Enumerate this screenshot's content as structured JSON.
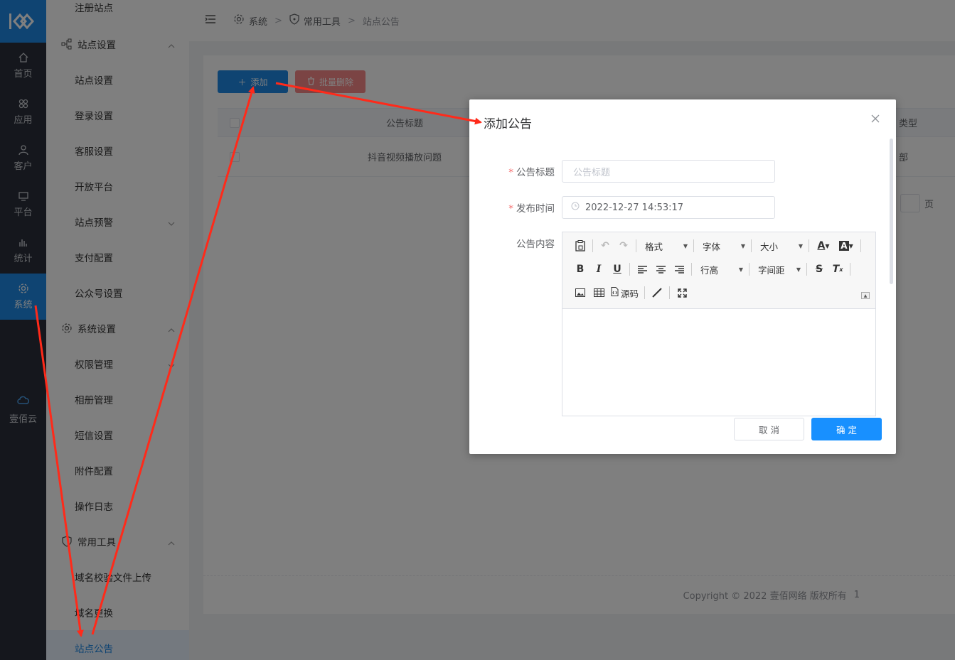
{
  "rail": {
    "items": [
      {
        "label": "首页",
        "icon": "home-icon"
      },
      {
        "label": "应用",
        "icon": "apps-icon"
      },
      {
        "label": "客户",
        "icon": "user-icon"
      },
      {
        "label": "平台",
        "icon": "monitor-icon"
      },
      {
        "label": "统计",
        "icon": "bar-chart-icon"
      },
      {
        "label": "系统",
        "icon": "gear-icon",
        "active": true
      }
    ],
    "cloud_label": "壹佰云"
  },
  "submenu": {
    "top_item": "注册站点",
    "group_site": "站点设置",
    "site_items": [
      "站点设置",
      "登录设置",
      "客服设置",
      "开放平台",
      "站点预警",
      "支付配置",
      "公众号设置"
    ],
    "group_system": "系统设置",
    "system_items": [
      "权限管理",
      "相册管理",
      "短信设置",
      "附件配置",
      "操作日志"
    ],
    "group_tools": "常用工具",
    "tools_items": [
      "域名校验文件上传",
      "域名更换",
      "站点公告"
    ]
  },
  "breadcrumb": {
    "level1": "系统",
    "level2": "常用工具",
    "level3": "站点公告"
  },
  "toolbar_buttons": {
    "add": "添加",
    "batch_delete": "批量删除"
  },
  "table": {
    "col_title": "公告标题",
    "col_type": "类型",
    "rows": [
      {
        "title": "抖音视频播放问题",
        "type": "部"
      }
    ]
  },
  "pager": {
    "page_suffix": "页"
  },
  "footer": {
    "copyright": "Copyright © 2022 壹佰网络 版权所有",
    "page": "1"
  },
  "dialog": {
    "title": "添加公告",
    "title_label": "公告标题",
    "title_placeholder": "公告标题",
    "time_label": "发布时间",
    "time_value": "2022-12-27 14:53:17",
    "content_label": "公告内容",
    "editor": {
      "format": "格式",
      "font": "字体",
      "size": "大小",
      "line_height": "行高",
      "letter_spacing": "字间距",
      "source": "源码"
    },
    "cancel": "取 消",
    "confirm": "确 定"
  },
  "colors": {
    "primary": "#1f89e5",
    "danger": "#f56c6c",
    "arrow": "#ff2a1a"
  }
}
